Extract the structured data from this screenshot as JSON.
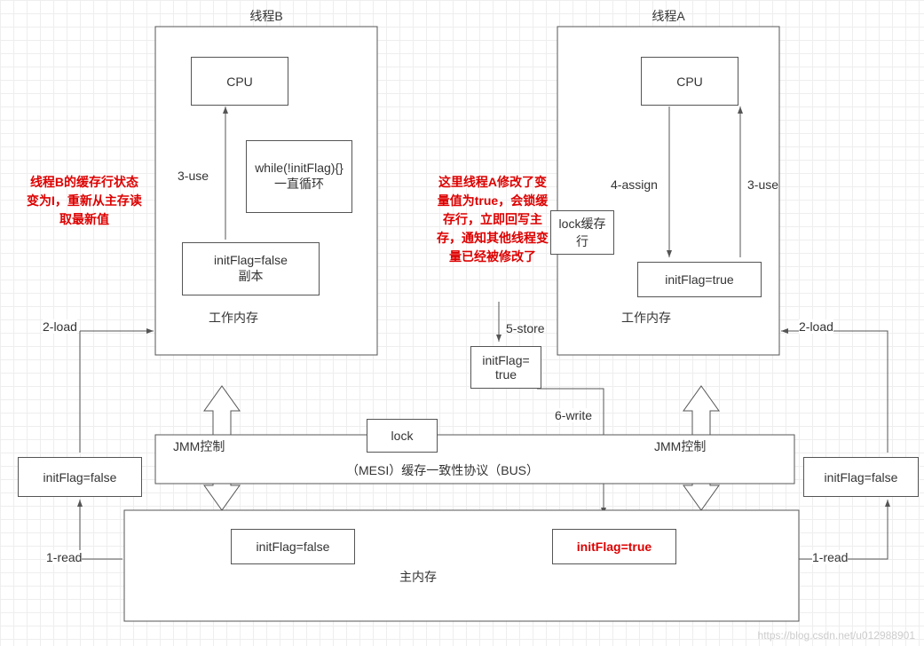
{
  "titles": {
    "threadB": "线程B",
    "threadA": "线程A"
  },
  "threadB": {
    "cpu": "CPU",
    "whileLoop": "while(!initFlag){}\n一直循环",
    "use": "3-use",
    "copyBox": "initFlag=false\n副本",
    "workMem": "工作内存"
  },
  "threadA": {
    "cpu": "CPU",
    "assign": "4-assign",
    "use": "3-use",
    "lockCache": "lock缓存行",
    "trueBox": "initFlag=true",
    "workMem": "工作内存"
  },
  "annotations": {
    "leftRed": "线程B的缓存行状态变为I，重新从主存读取最新值",
    "rightRed": "这里线程A修改了变量值为true，会锁缓存行，立即回写主存，通知其他线程变量已经被修改了"
  },
  "midFlow": {
    "store": "5-store",
    "storeBox": "initFlag=\ntrue",
    "write": "6-write",
    "lock": "lock",
    "jmmLeft": "JMM控制",
    "jmmRight": "JMM控制",
    "bus": "（MESI）缓存一致性协议（BUS）"
  },
  "mainMem": {
    "falseBox": "initFlag=false",
    "trueBox": "initFlag=true",
    "label": "主内存"
  },
  "sides": {
    "loadLeft": "2-load",
    "boxLeft": "initFlag=false",
    "readLeft": "1-read",
    "loadRight": "2-load",
    "boxRight": "initFlag=false",
    "readRight": "1-read"
  },
  "watermark": "https://blog.csdn.net/u012988901"
}
